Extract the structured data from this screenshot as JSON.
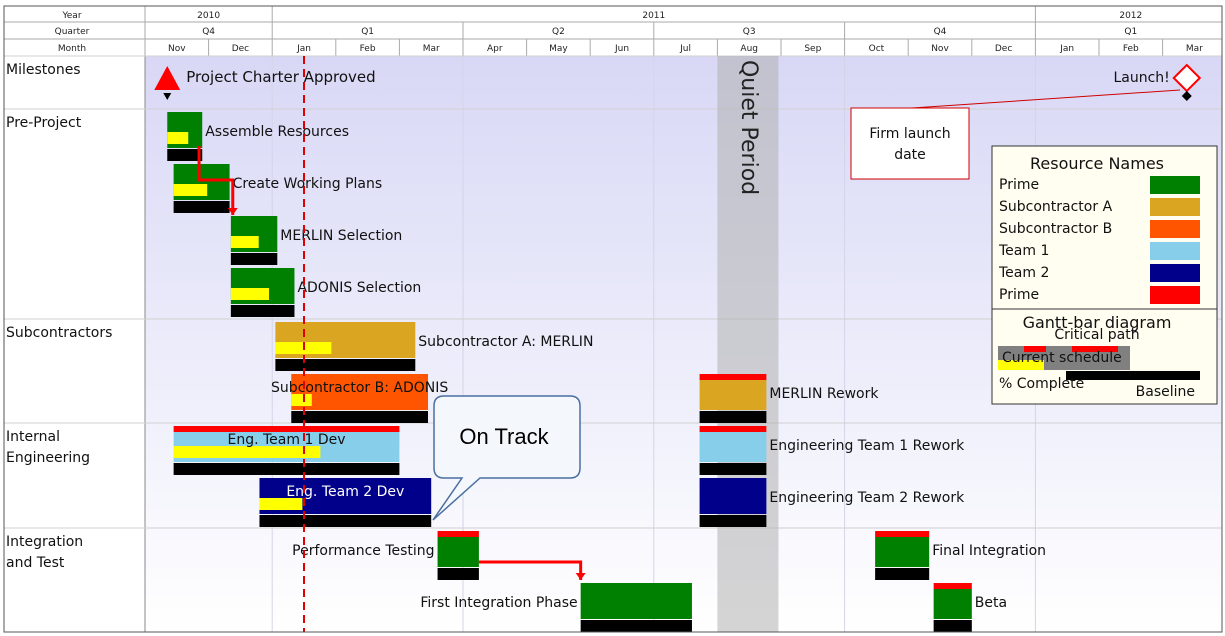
{
  "chart_data": {
    "type": "gantt",
    "header": {
      "row_labels": [
        "Year",
        "Quarter",
        "Month"
      ],
      "years": [
        {
          "label": "2010",
          "start": 0,
          "end": 2
        },
        {
          "label": "2011",
          "start": 2,
          "end": 14
        },
        {
          "label": "2012",
          "start": 14,
          "end": 17
        }
      ],
      "quarters": [
        {
          "label": "Q4",
          "start": 0,
          "end": 2
        },
        {
          "label": "Q1",
          "start": 2,
          "end": 5
        },
        {
          "label": "Q2",
          "start": 5,
          "end": 8
        },
        {
          "label": "Q3",
          "start": 8,
          "end": 11
        },
        {
          "label": "Q4",
          "start": 11,
          "end": 14
        },
        {
          "label": "Q1",
          "start": 14,
          "end": 17
        }
      ],
      "months": [
        "Nov",
        "Dec",
        "Jan",
        "Feb",
        "Mar",
        "Apr",
        "May",
        "Jun",
        "Jul",
        "Aug",
        "Sep",
        "Oct",
        "Nov",
        "Dec",
        "Jan",
        "Feb",
        "Mar"
      ]
    },
    "rows": [
      {
        "label": "Milestones"
      },
      {
        "label": "Pre-Project"
      },
      {
        "label": "Subcontractors"
      },
      {
        "label": "Internal\nEngineering"
      },
      {
        "label": "Integration\nand Test"
      }
    ],
    "status_line_month": 2.5,
    "quiet_period": {
      "label": "Quiet Period",
      "start": 9.0,
      "end": 9.96
    },
    "milestones": [
      {
        "label": "Project Charter Approved",
        "month": 0.35,
        "shape": "triangle",
        "color": "#ff0000"
      },
      {
        "label": "Launch!",
        "month": 16.38,
        "shape": "diamond",
        "color": "#ff0000"
      }
    ],
    "note": {
      "text": "Firm launch\ndate"
    },
    "tasks": [
      {
        "name": "Assemble Resources",
        "row": 1,
        "lane": 0,
        "start": 0.35,
        "end": 0.9,
        "color": "#008000",
        "complete": 0.6,
        "critical": false,
        "baseline": [
          0.35,
          0.9
        ]
      },
      {
        "name": "Create Working Plans",
        "row": 1,
        "lane": 1,
        "start": 0.45,
        "end": 1.33,
        "color": "#008000",
        "complete": 0.6,
        "critical": false,
        "baseline": [
          0.45,
          1.33
        ]
      },
      {
        "name": "MERLIN Selection",
        "row": 1,
        "lane": 2,
        "start": 1.35,
        "end": 2.08,
        "color": "#008000",
        "complete": 0.6,
        "critical": false,
        "baseline": [
          1.35,
          2.08
        ]
      },
      {
        "name": "ADONIS Selection",
        "row": 1,
        "lane": 3,
        "start": 1.35,
        "end": 2.35,
        "color": "#008000",
        "complete": 0.6,
        "critical": false,
        "baseline": [
          1.35,
          2.35
        ]
      },
      {
        "name": "Subcontractor A: MERLIN",
        "row": 2,
        "lane": 0,
        "start": 2.05,
        "end": 4.25,
        "color": "#daa520",
        "complete": 0.4,
        "critical": false,
        "baseline": [
          2.05,
          4.25
        ]
      },
      {
        "name": "Subcontractor B: ADONIS",
        "row": 2,
        "lane": 1,
        "start": 2.3,
        "end": 4.45,
        "color": "#ff5500",
        "complete": 0.15,
        "critical": false,
        "baseline": [
          2.3,
          4.45
        ]
      },
      {
        "name": "MERLIN Rework",
        "row": 2,
        "lane": 1,
        "start": 8.72,
        "end": 9.77,
        "color": "#daa520",
        "complete": 0,
        "critical": true,
        "baseline": [
          8.72,
          9.77
        ]
      },
      {
        "name": "Eng. Team 1 Dev",
        "row": 3,
        "lane": 0,
        "start": 0.45,
        "end": 4.0,
        "color": "#87ceeb",
        "complete": 0.65,
        "critical": true,
        "baseline": [
          0.45,
          4.0
        ]
      },
      {
        "name": "Engineering Team 1 Rework",
        "row": 3,
        "lane": 0,
        "start": 8.72,
        "end": 9.77,
        "color": "#87ceeb",
        "complete": 0,
        "critical": true,
        "baseline": [
          8.72,
          9.77
        ]
      },
      {
        "name": "Eng. Team 2 Dev",
        "row": 3,
        "lane": 1,
        "start": 1.8,
        "end": 4.5,
        "color": "#00008b",
        "complete": 0.25,
        "critical": false,
        "baseline": [
          1.8,
          4.5
        ]
      },
      {
        "name": "Engineering Team 2 Rework",
        "row": 3,
        "lane": 1,
        "start": 8.72,
        "end": 9.77,
        "color": "#00008b",
        "complete": 0,
        "critical": false,
        "baseline": [
          8.72,
          9.77
        ]
      },
      {
        "name": "Performance Testing",
        "row": 4,
        "lane": 0,
        "start": 4.6,
        "end": 5.25,
        "color": "#008000",
        "complete": 0,
        "critical": true,
        "baseline": [
          4.6,
          5.25
        ]
      },
      {
        "name": "Final Integration",
        "row": 4,
        "lane": 0,
        "start": 11.48,
        "end": 12.33,
        "color": "#008000",
        "complete": 0,
        "critical": true,
        "baseline": [
          11.48,
          12.33
        ]
      },
      {
        "name": "First Integration Phase",
        "row": 4,
        "lane": 1,
        "start": 6.85,
        "end": 8.6,
        "color": "#008000",
        "complete": 0,
        "critical": false,
        "baseline": [
          6.85,
          8.6
        ]
      },
      {
        "name": "Beta",
        "row": 4,
        "lane": 1,
        "start": 12.4,
        "end": 13.0,
        "color": "#008000",
        "complete": 0,
        "critical": true,
        "baseline": [
          12.4,
          13.0
        ]
      }
    ],
    "callout": {
      "text": "On Track"
    },
    "legend": {
      "title": "Resource Names",
      "items": [
        {
          "name": "Prime",
          "color": "#008000"
        },
        {
          "name": "Subcontractor A",
          "color": "#daa520"
        },
        {
          "name": "Subcontractor B",
          "color": "#ff5500"
        },
        {
          "name": "Team 1",
          "color": "#87ceeb"
        },
        {
          "name": "Team 2",
          "color": "#00008b"
        },
        {
          "name": "Prime",
          "color": "#ff0000"
        }
      ],
      "bar_title": "Gantt-bar diagram",
      "bar_labels": [
        "Critical path",
        "Current schedule",
        "% Complete",
        "Baseline"
      ]
    }
  }
}
